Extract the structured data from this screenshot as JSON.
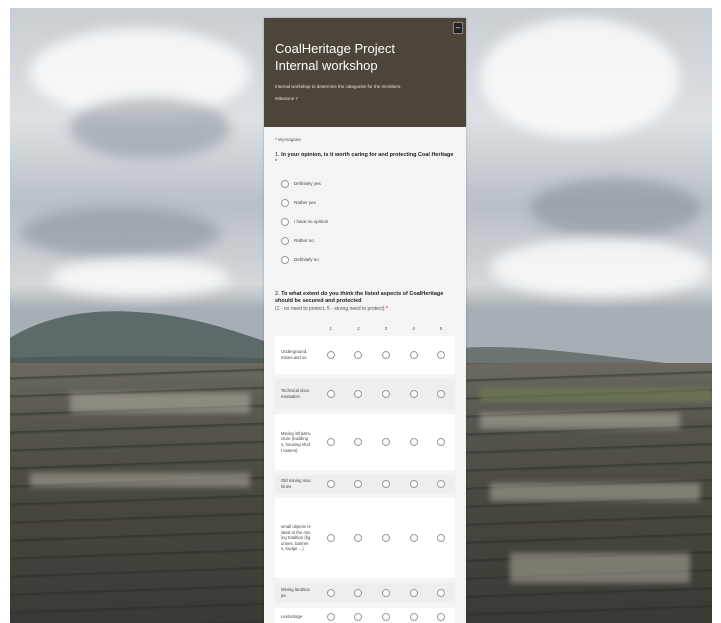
{
  "form": {
    "title": "CoalHeritage Project",
    "subtitle": "Internal workshop",
    "description": "Internal workshop to determine the categories for the members.",
    "milestone": "Milestone 7",
    "required_note": "* Wymagane",
    "collapse_glyph": "–"
  },
  "question1": {
    "number": "1.",
    "text": "In your opinion, is it worth caring for and protecting Coal Heritage",
    "required_mark": "*",
    "options": [
      "Definitely yes",
      "Rather yes",
      "I have no opinion",
      "Rather no",
      "Definitely no"
    ]
  },
  "question2": {
    "number": "2.",
    "text": "To what extent do you think the listed aspects of CoalHeritage should be secured and protected",
    "help": "(1 - no need to protect, 5 - strong need to protect)",
    "required_mark": "*",
    "columns": [
      "1",
      "2",
      "3",
      "4",
      "5"
    ],
    "rows": [
      "Underground, mines and so",
      "Technical documentation",
      "Mining infrastructure (buildings, housing shaft towers)",
      "Old mining machines",
      "small objects related to the mining tradition (figurines, banners, bodge ...)",
      "Mining landscape",
      "Lestoritage"
    ]
  }
}
